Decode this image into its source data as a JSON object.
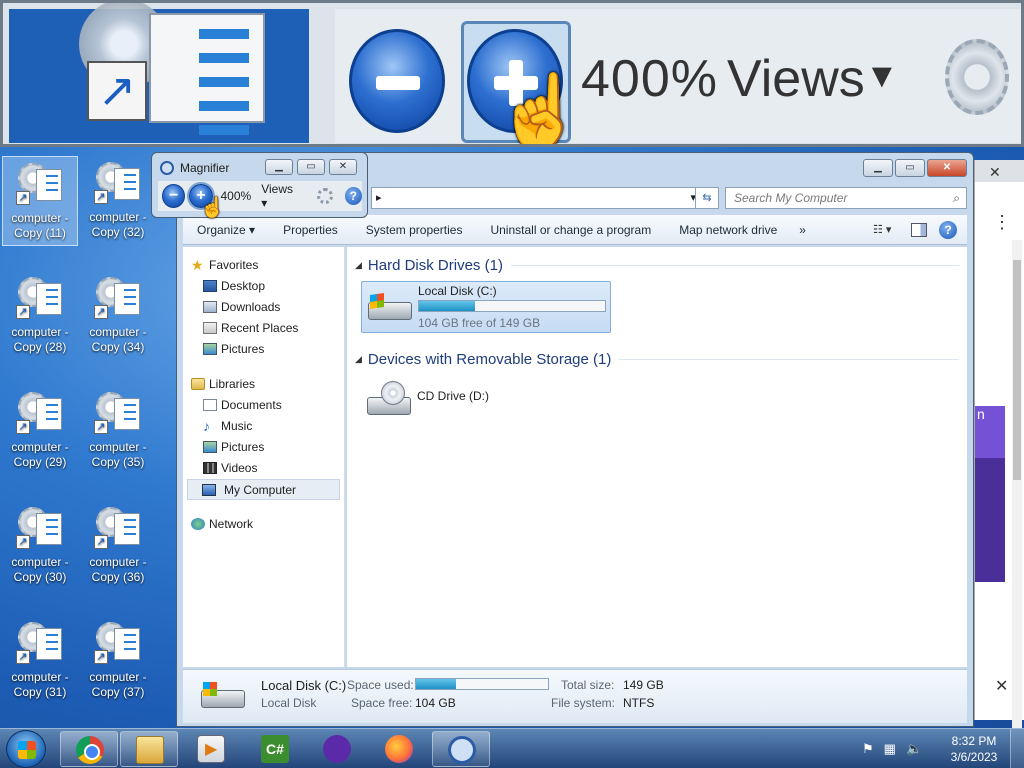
{
  "desktop": {
    "icons": [
      {
        "label": "computer - Copy (11)"
      },
      {
        "label": "computer - Copy (32)"
      },
      {
        "label": "computer - Copy (28)"
      },
      {
        "label": "computer - Copy (34)"
      },
      {
        "label": "computer - Copy (29)"
      },
      {
        "label": "computer - Copy (35)"
      },
      {
        "label": "computer - Copy (30)"
      },
      {
        "label": "computer - Copy (36)"
      },
      {
        "label": "computer - Copy (31)"
      },
      {
        "label": "computer - Copy (37)"
      }
    ]
  },
  "zoom_view": {
    "zoom_level": "400%",
    "views_label": "Views"
  },
  "magnifier": {
    "title": "Magnifier",
    "zoom_out_glyph": "−",
    "zoom_in_glyph": "+",
    "zoom_level": "400%",
    "views_label": "Views",
    "help_glyph": "?"
  },
  "explorer": {
    "search_placeholder": "Search My Computer",
    "toolbar": {
      "organize": "Organize",
      "properties": "Properties",
      "system_properties": "System properties",
      "uninstall": "Uninstall or change a program",
      "map_network": "Map network drive",
      "more": "»"
    },
    "nav": {
      "favorites": "Favorites",
      "desktop": "Desktop",
      "downloads": "Downloads",
      "recent_places": "Recent Places",
      "pictures_fav": "Pictures",
      "libraries": "Libraries",
      "documents": "Documents",
      "music": "Music",
      "pictures_lib": "Pictures",
      "videos": "Videos",
      "my_computer": "My Computer",
      "network": "Network"
    },
    "groups": {
      "hard_disks": "Hard Disk Drives (1)",
      "removable": "Devices with Removable Storage (1)"
    },
    "local_disk": {
      "name": "Local Disk (C:)",
      "free_text": "104 GB free of 149 GB",
      "used_fraction": 0.3
    },
    "cd_drive": {
      "name": "CD Drive (D:)"
    },
    "details": {
      "name": "Local Disk (C:)",
      "type": "Local Disk",
      "space_used_label": "Space used:",
      "space_free_label": "Space free:",
      "space_free_value": "104 GB",
      "total_size_label": "Total size:",
      "total_size_value": "149 GB",
      "file_system_label": "File system:",
      "file_system_value": "NTFS",
      "used_fraction": 0.3
    }
  },
  "taskbar": {
    "time": "8:32 PM",
    "date": "3/6/2023",
    "csharp_label": "C#"
  },
  "colors": {
    "accent": "#1d90c4",
    "desktop_blue": "#2f79cf"
  }
}
